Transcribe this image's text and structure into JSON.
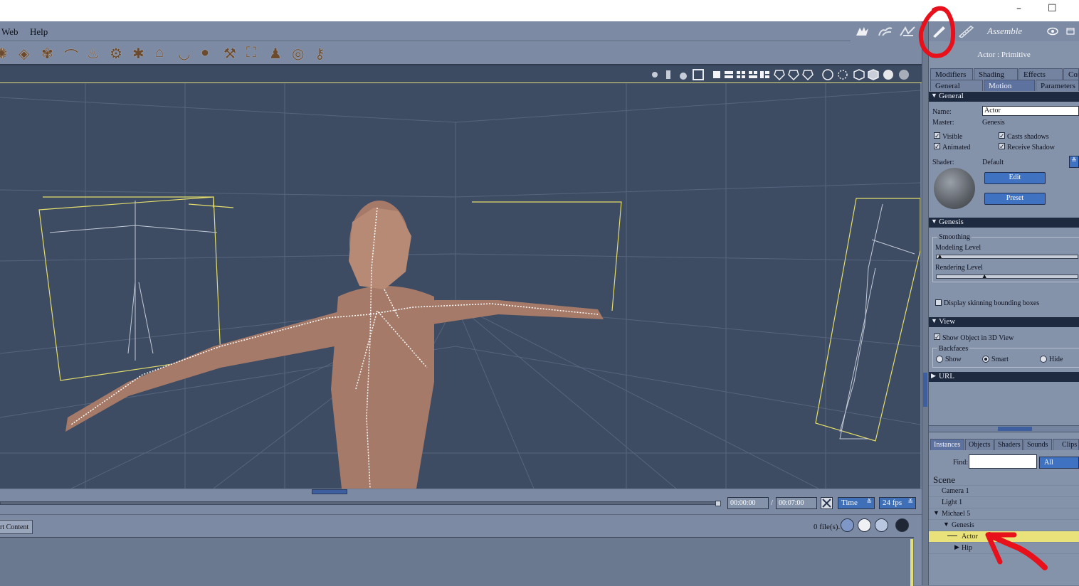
{
  "window": {
    "minimize": "–",
    "maximize": "☐"
  },
  "menu": {
    "web": "Web",
    "help": "Help"
  },
  "rooms": {
    "items": [
      "hand-room-icon",
      "pose-room-icon",
      "bone-room-icon",
      "setup-room-icon",
      "ruler-room-icon"
    ],
    "current": "Assemble",
    "eye_icon": "eye-icon",
    "window_icon": "panel-toggle-icon"
  },
  "toolbar": {
    "tools": [
      "gear-icon",
      "stack-icon",
      "tree-icon",
      "hat-icon",
      "flame-icon",
      "pile-icon",
      "grass-icon",
      "house-icon",
      "bowl-icon",
      "blob-icon",
      "hammer-icon",
      "camera-icon",
      "figure-icon",
      "target-icon",
      "wrench-icon"
    ]
  },
  "timeline": {
    "current_time": "00:00:00",
    "separator": "/",
    "end_time": "00:07:00",
    "mode": "Time",
    "fps": "24 fps"
  },
  "content": {
    "tab_label": "rt Content",
    "file_count": "0 file(s)."
  },
  "panel": {
    "title": "Actor : Primitive",
    "tabs_row1": [
      "Modifiers",
      "Shading",
      "Effects",
      "Controlle"
    ],
    "tabs_row2": [
      "General",
      "Motion",
      "Parameters"
    ],
    "active_tab": "Motion",
    "general": {
      "header": "General",
      "name_label": "Name:",
      "name_value": "Actor",
      "master_label": "Master:",
      "master_value": "Genesis",
      "visible": "Visible",
      "animated": "Animated",
      "casts_shadows": "Casts shadows",
      "receive_shadow": "Receive Shadow",
      "shader_label": "Shader:",
      "shader_value": "Default",
      "edit": "Edit",
      "preset": "Preset"
    },
    "genesis": {
      "header": "Genesis",
      "smoothing": "Smoothing",
      "modeling_level": "Modeling Level",
      "modeling_value": 0.0,
      "rendering_level": "Rendering Level",
      "rendering_value": 0.33,
      "display_skinning": "Display skinning bounding boxes"
    },
    "view": {
      "header": "View",
      "show_object": "Show Object in 3D View",
      "backfaces": "Backfaces",
      "show": "Show",
      "smart": "Smart",
      "hide": "Hide",
      "selected": "Smart"
    },
    "url": {
      "header": "URL"
    }
  },
  "list": {
    "tabs": [
      "Instances",
      "Objects",
      "Shaders",
      "Sounds",
      "Clips"
    ],
    "active_tab": "Instances",
    "find_label": "Find:",
    "find_value": "",
    "filter": "All",
    "scene_label": "Scene",
    "items": [
      {
        "label": "Camera 1",
        "indent": 0
      },
      {
        "label": "Light 1",
        "indent": 0
      },
      {
        "label": "Michael 5",
        "indent": 0
      },
      {
        "label": "Genesis",
        "indent": 1
      },
      {
        "label": "Actor",
        "indent": 2,
        "selected": true
      },
      {
        "label": "Hip",
        "indent": 2
      }
    ]
  },
  "colors": {
    "accent_blue": "#3f73c2",
    "selection_yellow": "#e9e27a",
    "viewport_bg": "#3d4b63",
    "annotation_red": "#e8101a"
  }
}
